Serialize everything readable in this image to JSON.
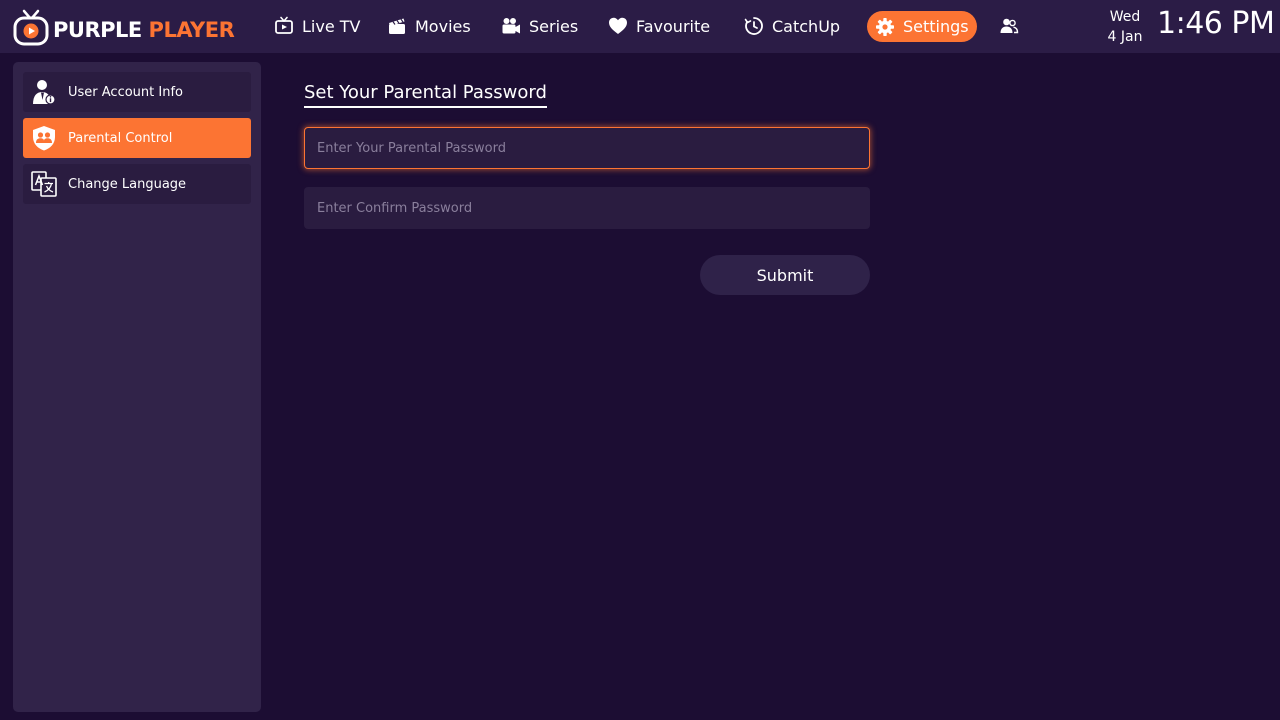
{
  "app": {
    "logo_word_1": "PURPLE",
    "logo_word_2": "PLAYER"
  },
  "nav": {
    "items": [
      {
        "label": "Live TV",
        "icon": "tv-icon"
      },
      {
        "label": "Movies",
        "icon": "clapperboard-icon"
      },
      {
        "label": "Series",
        "icon": "film-camera-icon"
      },
      {
        "label": "Favourite",
        "icon": "heart-icon"
      },
      {
        "label": "CatchUp",
        "icon": "history-clock-icon"
      },
      {
        "label": "Settings",
        "icon": "gear-icon",
        "active": true
      }
    ],
    "profile_icon": "users-icon"
  },
  "datetime": {
    "day": "Wed",
    "date": "4 Jan",
    "time": "1:46 PM"
  },
  "sidebar": {
    "items": [
      {
        "label": "User Account Info",
        "icon": "user-info-icon"
      },
      {
        "label": "Parental Control",
        "icon": "parental-shield-icon",
        "active": true
      },
      {
        "label": "Change Language",
        "icon": "language-icon"
      }
    ]
  },
  "form": {
    "title": "Set Your Parental Password",
    "password_placeholder": "Enter Your Parental Password",
    "password_value": "",
    "confirm_placeholder": "Enter Confirm Password",
    "confirm_value": "",
    "submit_label": "Submit"
  },
  "colors": {
    "accent": "#fc7433",
    "background": "#1c0d33",
    "topbar": "#2b1c46",
    "sidebar": "#312349"
  }
}
